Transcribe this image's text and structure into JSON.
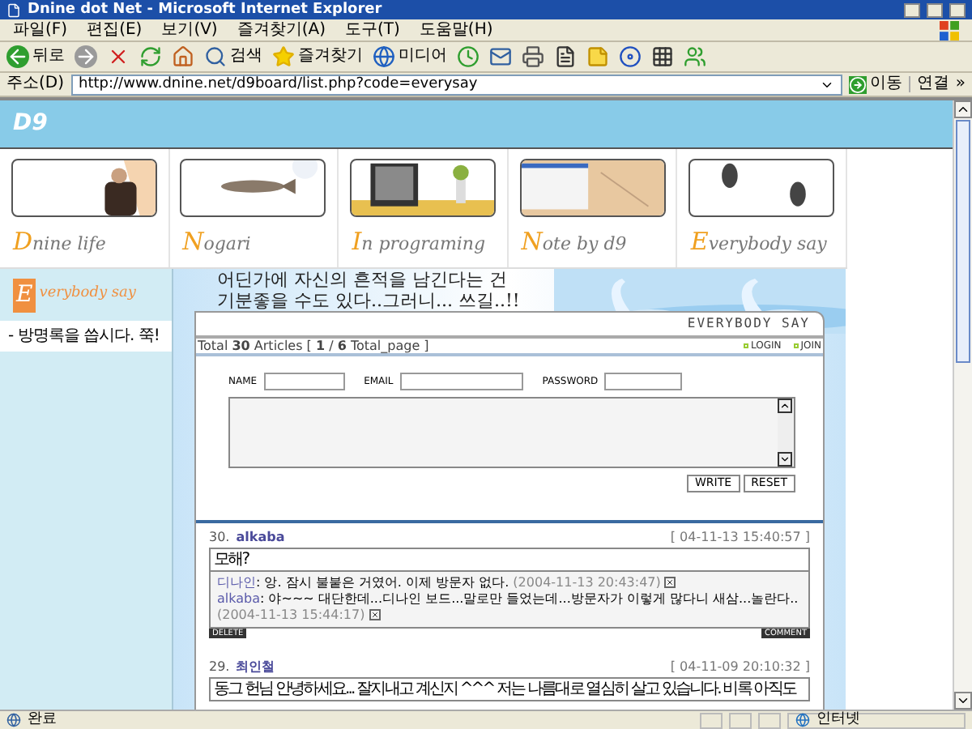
{
  "window": {
    "title": "Dnine dot Net - Microsoft Internet Explorer"
  },
  "menu": [
    "파일(F)",
    "편집(E)",
    "보기(V)",
    "즐겨찾기(A)",
    "도구(T)",
    "도움말(H)"
  ],
  "toolbar": [
    {
      "kind": "back",
      "label": "뒤로"
    },
    {
      "kind": "forward"
    },
    {
      "kind": "stop"
    },
    {
      "kind": "refresh"
    },
    {
      "kind": "home"
    },
    {
      "kind": "search",
      "label": "검색"
    },
    {
      "kind": "favorites",
      "label": "즐겨찾기"
    },
    {
      "kind": "media",
      "label": "미디어"
    },
    {
      "kind": "history"
    },
    {
      "kind": "mail"
    },
    {
      "kind": "print"
    },
    {
      "kind": "edit"
    },
    {
      "kind": "note"
    },
    {
      "kind": "app"
    },
    {
      "kind": "app2"
    },
    {
      "kind": "messenger"
    }
  ],
  "address": {
    "label": "주소(D)",
    "url": "http://www.dnine.net/d9board/list.php?code=everysay",
    "go": "이동",
    "links": "연결",
    "more": "»"
  },
  "site": {
    "logo": "D9",
    "nav": [
      {
        "first": "D",
        "rest": "nine life"
      },
      {
        "first": "N",
        "rest": "ogari"
      },
      {
        "first": "I",
        "rest": "n programing"
      },
      {
        "first": "N",
        "rest": "ote by d9"
      },
      {
        "first": "E",
        "rest": "verybody say"
      }
    ],
    "sidebar": {
      "logo_first": "E",
      "logo_rest": "verybody say",
      "items": [
        "- 방명록을 씁시다. 쭉!"
      ]
    },
    "heading": [
      "어딘가에 자신의 흔적을 남긴다는 건",
      "기분좋을 수도 있다..그러니... 쓰길..!!"
    ],
    "board_title": "EVERYBODY SAY",
    "links": [
      "LOGIN",
      "JOIN"
    ],
    "total": "Total **30** Articles [ **1** / **6** Total_page ]",
    "form": {
      "name": "NAME",
      "email": "EMAIL",
      "password": "PASSWORD",
      "buttons": [
        "WRITE",
        "RESET"
      ]
    },
    "posts": [
      {
        "number": "30.",
        "author": "alkaba",
        "date": "[ 04-11-13 15:40:57 ]",
        "body": "모해?",
        "comments": [
          {
            "author": "디나인",
            "text": ": 앙. 잠시 불붙은 거였어. 이제 방문자 없다.",
            "date": "(2004-11-13 20:43:47)"
          },
          {
            "author": "alkaba",
            "text": ": 야~~~ 대단한데...디나인 보드...말로만 들었는데...방문자가 이렇게 많다니 새삼...놀란다..",
            "date": "(2004-11-13 15:44:17)"
          }
        ],
        "delete": "DELETE",
        "comment": "COMMENT"
      },
      {
        "number": "29.",
        "author": "최인철",
        "date": "[ 04-11-09 20:10:32 ]",
        "body": "동그 헌님 안녕하세요... 잘지내고 계신지 ^^^ 저는 나름대로 열심히 살고 있습니다. 비록 아직도"
      }
    ]
  },
  "status": {
    "text": "완료",
    "zone": "인터넷"
  }
}
